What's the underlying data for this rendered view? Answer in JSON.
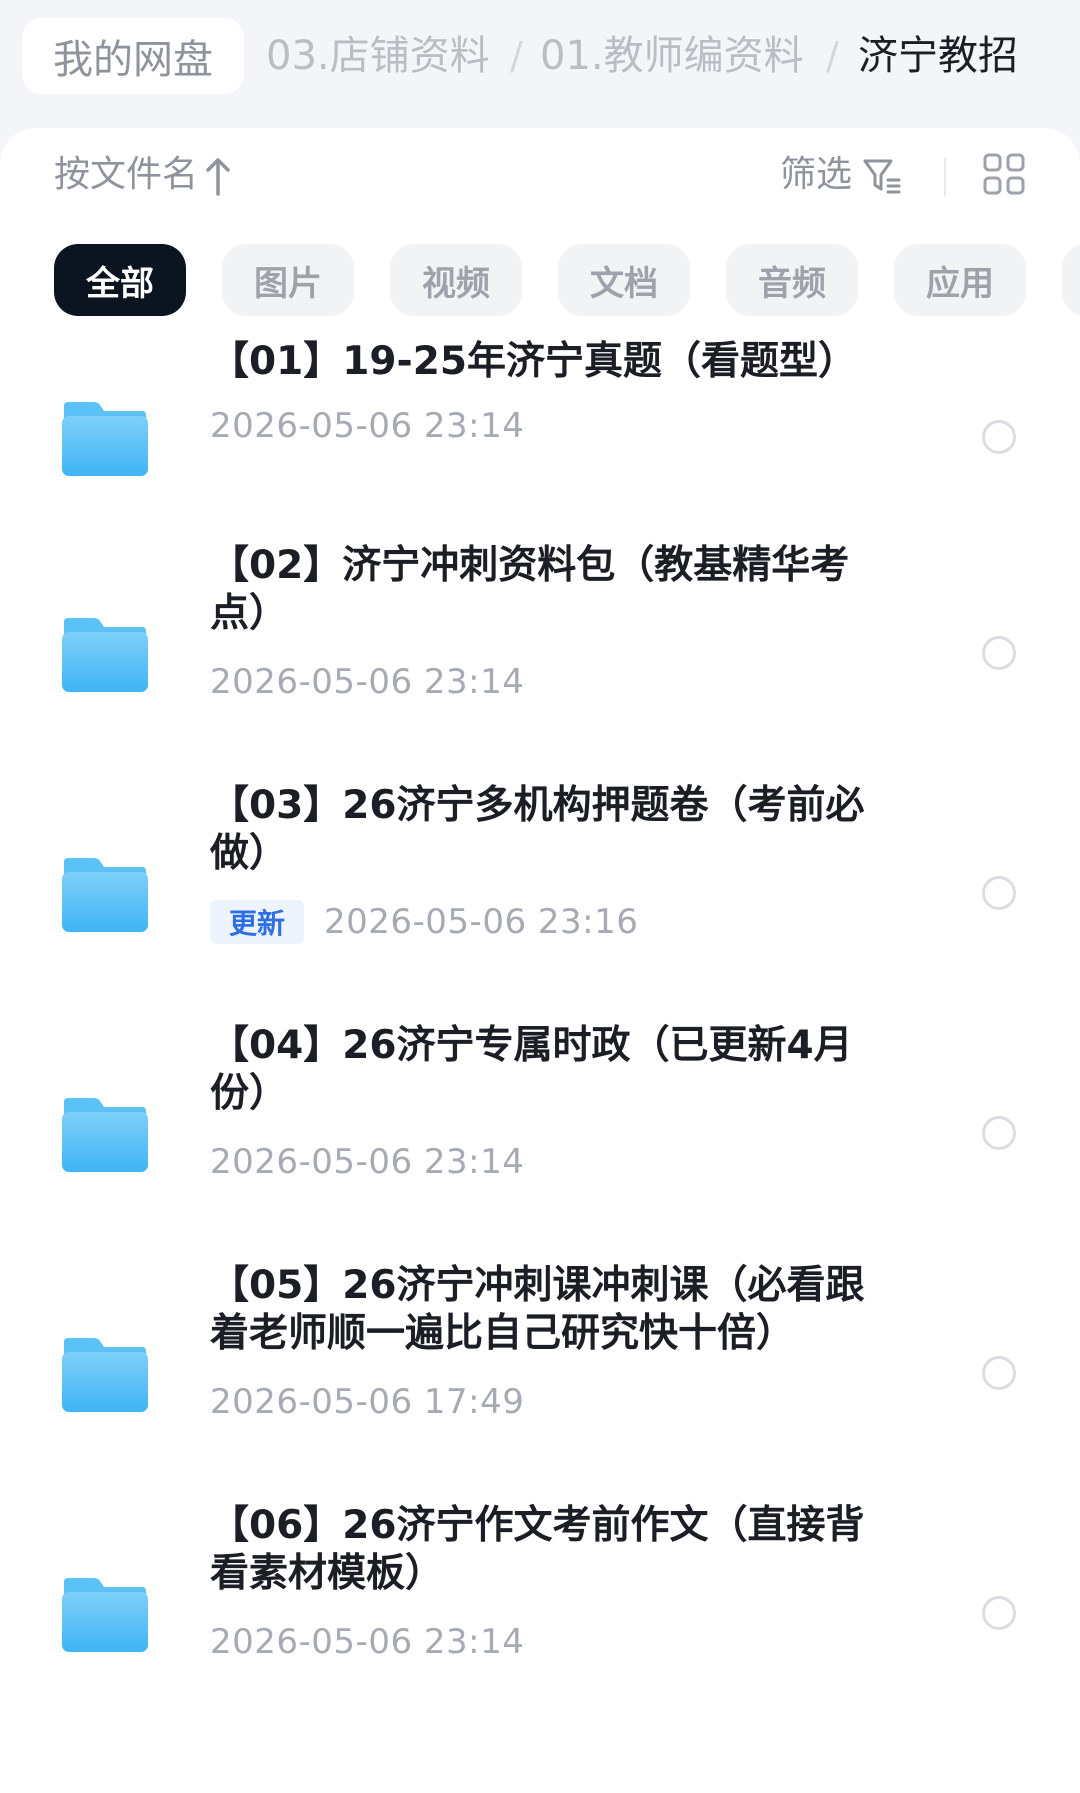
{
  "breadcrumb": {
    "home": "我的网盘",
    "level1": "03.店铺资料",
    "separator": "/",
    "level2": "01.教师编资料",
    "current": "济宁教招"
  },
  "toolbar": {
    "sort_label": "按文件名",
    "sort_icon": "arrow-up-icon",
    "filter_label": "筛选",
    "filter_icon": "filter-icon",
    "view_icon": "grid-view-icon"
  },
  "chips": [
    "全部",
    "图片",
    "视频",
    "文档",
    "音频",
    "应用"
  ],
  "active_chip": "全部",
  "files": [
    {
      "title": "【01】19-25年济宁真题（看题型）",
      "date": "2026-05-06  23:14",
      "badge": ""
    },
    {
      "title": "【02】济宁冲刺资料包（教基精华考点）",
      "date": "2026-05-06  23:14",
      "badge": ""
    },
    {
      "title": "【03】26济宁多机构押题卷（考前必做）",
      "date": "2026-05-06  23:16",
      "badge": "更新"
    },
    {
      "title": "【04】26济宁专属时政（已更新4月份）",
      "date": "2026-05-06  23:14",
      "badge": ""
    },
    {
      "title": "【05】26济宁冲刺课冲刺课（必看跟着老师顺一遍比自己研究快十倍）",
      "date": "2026-05-06  17:49",
      "badge": ""
    },
    {
      "title": "【06】26济宁作文考前作文（直接背看素材模板）",
      "date": "2026-05-06  23:14",
      "badge": ""
    }
  ],
  "colors": {
    "background": "#f3f5f8",
    "chip_active": "#0c1420",
    "folder_top": "#7fd0fa",
    "folder_bottom": "#3fb4f4",
    "badge_text": "#2f6fe4"
  }
}
